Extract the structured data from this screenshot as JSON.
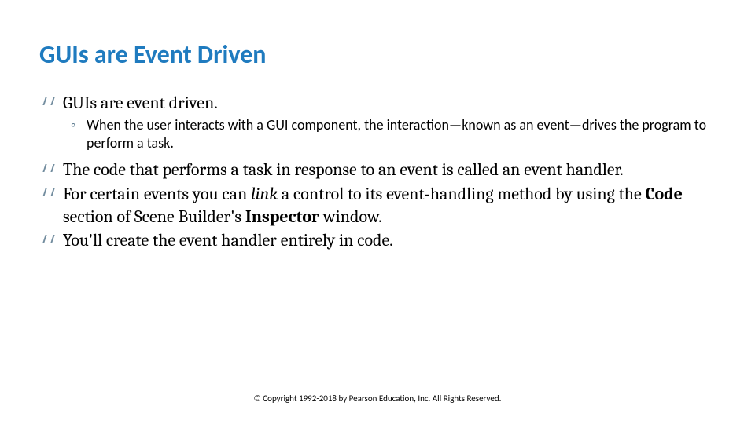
{
  "title": "GUIs are Event Driven",
  "bullets": {
    "b1": "GUIs are event driven.",
    "b1sub": "When the user interacts with a GUI component, the interaction—known as an event—drives the program to perform a task.",
    "b2": "The code that performs a task in response to an event is called an event handler.",
    "b3_pre": "For certain events you can ",
    "b3_link": "link",
    "b3_mid": " a control to its event-handling method by using the ",
    "b3_code": "Code",
    "b3_mid2": " section of Scene Builder's ",
    "b3_insp": "Inspector",
    "b3_end": " window.",
    "b4": "You'll create the event handler entirely in code."
  },
  "footer": "© Copyright 1992-2018 by Pearson Education, Inc. All Rights Reserved."
}
